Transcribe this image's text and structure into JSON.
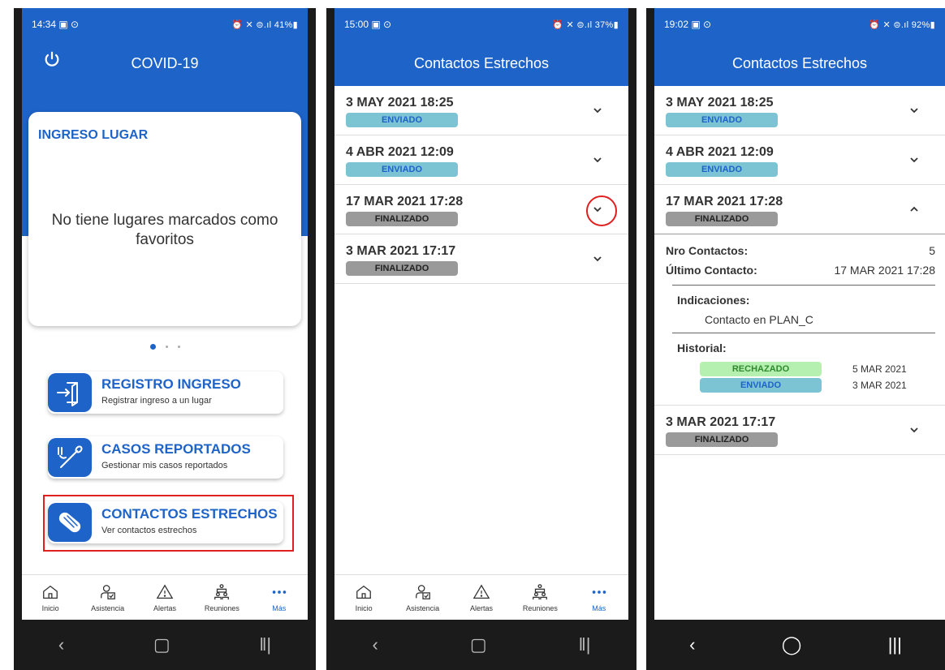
{
  "screen1": {
    "status": {
      "time": "14:34 ▣ ⊙",
      "right": "⏰ ✕ ⊜.ıl 41%▮"
    },
    "title": "COVID-19",
    "card": {
      "title": "INGRESO LUGAR",
      "message": "No tiene lugares marcados como favoritos"
    },
    "buttons": [
      {
        "title": "REGISTRO INGRESO",
        "subtitle": "Registrar ingreso a un lugar",
        "icon": "door-enter-icon"
      },
      {
        "title": "CASOS REPORTADOS",
        "subtitle": "Gestionar mis casos reportados",
        "icon": "swab-icon"
      },
      {
        "title": "CONTACTOS ESTRECHOS",
        "subtitle": "Ver contactos estrechos",
        "icon": "bandage-icon"
      }
    ]
  },
  "screen2": {
    "status": {
      "time": "15:00 ▣ ⊙",
      "right": "⏰ ✕ ⊜.ıl 37%▮"
    },
    "title": "Contactos Estrechos",
    "items": [
      {
        "date": "3 MAY 2021 18:25",
        "status": "ENVIADO"
      },
      {
        "date": "4 ABR 2021 12:09",
        "status": "ENVIADO"
      },
      {
        "date": "17 MAR 2021 17:28",
        "status": "FINALIZADO"
      },
      {
        "date": "3 MAR 2021 17:17",
        "status": "FINALIZADO"
      }
    ]
  },
  "screen3": {
    "status": {
      "time": "19:02 ▣ ⊙",
      "right": "⏰ ✕ ⊜.ıl 92%▮"
    },
    "title": "Contactos Estrechos",
    "items": [
      {
        "date": "3 MAY 2021 18:25",
        "status": "ENVIADO"
      },
      {
        "date": "4 ABR 2021 12:09",
        "status": "ENVIADO"
      },
      {
        "date": "17 MAR 2021 17:28",
        "status": "FINALIZADO"
      },
      {
        "date": "3 MAR 2021 17:17",
        "status": "FINALIZADO"
      }
    ],
    "detail": {
      "nro_label": "Nro Contactos:",
      "nro_value": "5",
      "ultimo_label": "Último Contacto:",
      "ultimo_value": "17 MAR 2021 17:28",
      "indicaciones_label": "Indicaciones:",
      "indicaciones_value": "Contacto en PLAN_C",
      "historial_label": "Historial:",
      "historial": [
        {
          "status": "RECHAZADO",
          "date": "5 MAR 2021"
        },
        {
          "status": "ENVIADO",
          "date": "3 MAR 2021"
        }
      ]
    }
  },
  "nav": [
    "Inicio",
    "Asistencia",
    "Alertas",
    "Reuniones",
    "Más"
  ],
  "colors": {
    "primary": "#1e63c8",
    "enviado": "#7cc3d4",
    "finalizado": "#9a9a9a",
    "rechazado": "#b6f0b0",
    "highlight": "#e02020"
  }
}
